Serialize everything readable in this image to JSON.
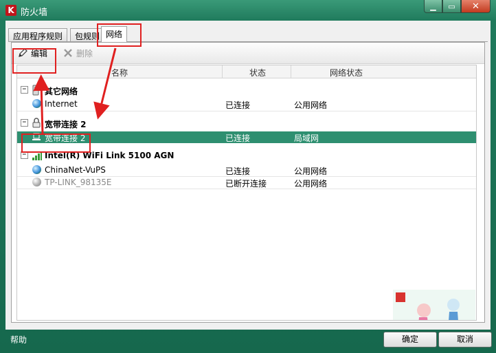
{
  "window": {
    "title": "防火墙"
  },
  "tabs": [
    {
      "label": "应用程序规则"
    },
    {
      "label": "包规则"
    },
    {
      "label": "网络"
    }
  ],
  "toolbar": {
    "edit_label": "编辑",
    "delete_label": "删除"
  },
  "table": {
    "columns": [
      "名称",
      "状态",
      "网络状态"
    ],
    "groups": [
      {
        "name": "其它网络",
        "icon": "network-group-icon",
        "rows": [
          {
            "name": "Internet",
            "status": "已连接",
            "net_status": "公用网络"
          }
        ]
      },
      {
        "name": "宽带连接 2",
        "icon": "lock-icon",
        "rows": [
          {
            "name": "宽带连接 2",
            "status": "已连接",
            "net_status": "局域网",
            "selected": true
          }
        ]
      },
      {
        "name": "Intel(R) WiFi Link 5100 AGN",
        "icon": "wifi-signal-icon",
        "rows": [
          {
            "name": "ChinaNet-VuPS",
            "status": "已连接",
            "net_status": "公用网络"
          },
          {
            "name": "TP-LINK_98135E",
            "status": "已断开连接",
            "net_status": "公用网络"
          }
        ]
      }
    ]
  },
  "footer": {
    "help_label": "帮助",
    "ok_label": "确定",
    "cancel_label": "取消"
  },
  "colors": {
    "selection": "#2e8f70",
    "annotation": "#e02020",
    "frame": "#1f7a5c"
  }
}
